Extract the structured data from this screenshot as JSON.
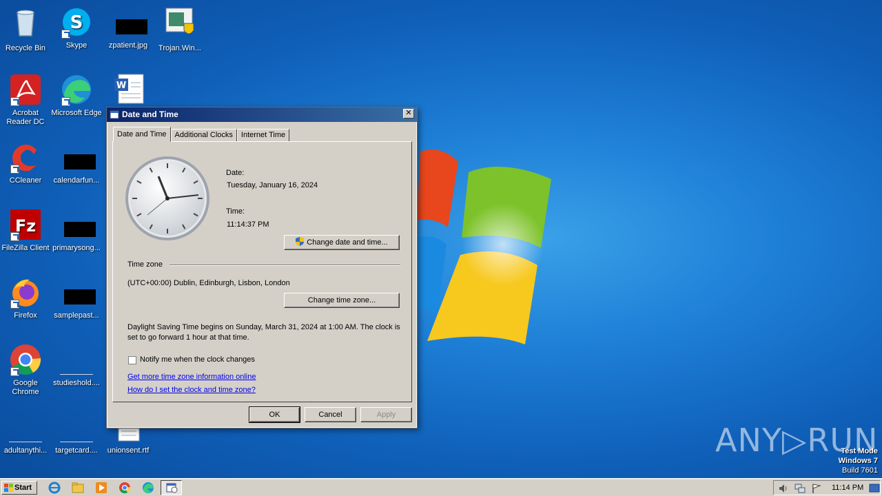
{
  "desktop": {
    "icons": [
      {
        "label": "Recycle Bin"
      },
      {
        "label": "Skype"
      },
      {
        "label": "zpatient.jpg"
      },
      {
        "label": "Trojan.Win..."
      },
      {
        "label": "Acrobat Reader DC"
      },
      {
        "label": "Microsoft Edge"
      },
      {
        "label": "CCleaner"
      },
      {
        "label": "calendarfun..."
      },
      {
        "label": "FileZilla Client"
      },
      {
        "label": "primarysong..."
      },
      {
        "label": "Firefox"
      },
      {
        "label": "samplepast..."
      },
      {
        "label": "Google Chrome"
      },
      {
        "label": "studieshold...."
      },
      {
        "label": "adultanythi..."
      },
      {
        "label": "targetcard...."
      },
      {
        "label": "unionsent.rtf"
      }
    ]
  },
  "watermark": {
    "brand": "ANY▷RUN",
    "test_mode": "Test Mode",
    "os": "Windows 7",
    "build": "Build 7601"
  },
  "dialog": {
    "title": "Date and Time",
    "close_glyph": "✕",
    "tabs": [
      {
        "label": "Date and Time",
        "active": true
      },
      {
        "label": "Additional Clocks",
        "active": false
      },
      {
        "label": "Internet Time",
        "active": false
      }
    ],
    "date_label": "Date:",
    "date_value": "Tuesday, January 16, 2024",
    "time_label": "Time:",
    "time_value": "11:14:37 PM",
    "change_datetime_btn": "Change date and time...",
    "timezone_section": "Time zone",
    "timezone_value": "(UTC+00:00) Dublin, Edinburgh, Lisbon, London",
    "change_timezone_btn": "Change time zone...",
    "dst_text": "Daylight Saving Time begins on Sunday, March 31, 2024 at 1:00 AM. The clock is set to go forward 1 hour at that time.",
    "notify_checkbox": {
      "label": "Notify me when the clock changes",
      "checked": false
    },
    "link_more_info": "Get more time zone information online",
    "link_how_to": "How do I set the clock and time zone?",
    "ok_btn": "OK",
    "cancel_btn": "Cancel",
    "apply_btn": "Apply"
  },
  "taskbar": {
    "start_label": "Start",
    "clock": "11:14 PM"
  },
  "colors": {
    "desktop_bg": "#1e7fd6",
    "dialog_bg": "#d4d0c8",
    "titlebar": "#0a246a",
    "link": "#0000ee"
  }
}
